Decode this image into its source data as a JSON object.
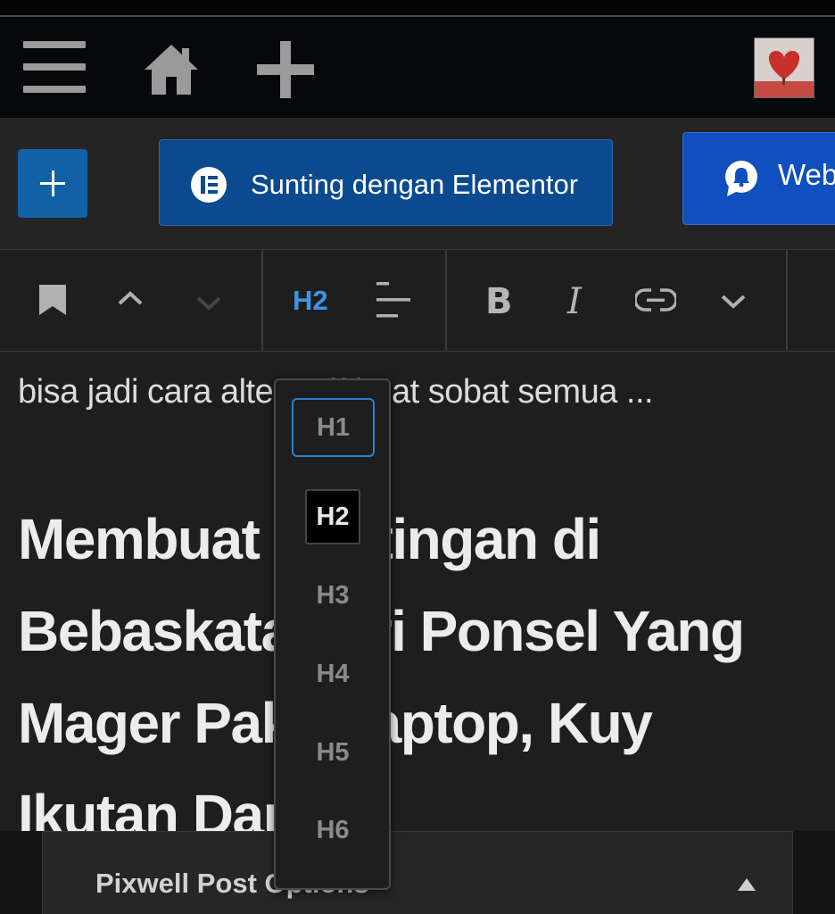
{
  "header": {
    "elementor_button_label": "Sunting dengan Elementor",
    "web_button_label": "Web"
  },
  "toolbar": {
    "heading_level": "H2",
    "bold_label": "B",
    "italic_label": "I"
  },
  "content": {
    "excerpt": "bisa jadi cara alternatif buat sobat semua ...",
    "heading": "Membuat Postingan di Bebaskata dari Ponsel Yang Mager Pake Laptop, Kuy Ikutan Dapat."
  },
  "heading_dropdown": {
    "levels": [
      "H1",
      "H2",
      "H3",
      "H4",
      "H5",
      "H6"
    ],
    "selected": "H2"
  },
  "panel": {
    "title": "Pixwell Post Options"
  },
  "colors": {
    "accent": "#3d94e6",
    "primary_button": "#0b4a8f",
    "web_button": "#0f4fbe"
  },
  "icons": [
    "menu-icon",
    "home-icon",
    "plus-icon",
    "elementor-icon",
    "bell-icon",
    "bookmark-icon",
    "chevron-up-icon",
    "chevron-down-icon",
    "align-icon",
    "link-icon",
    "more-chevron-icon"
  ]
}
